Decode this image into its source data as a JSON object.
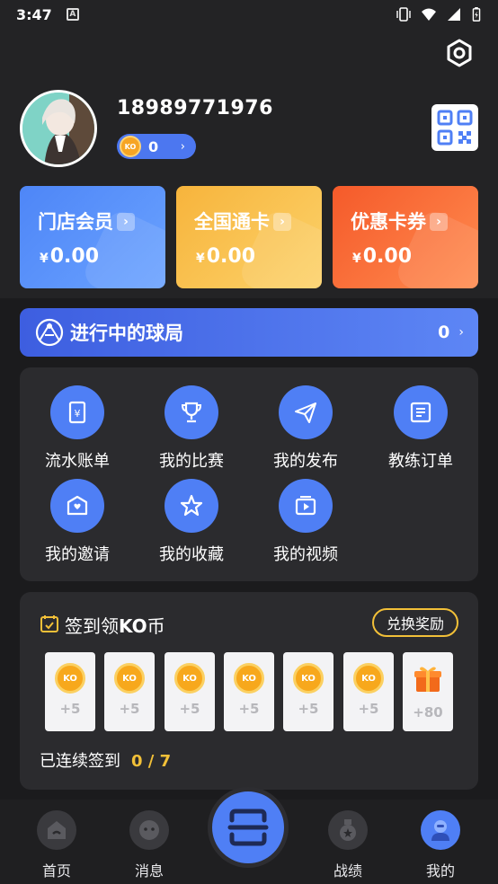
{
  "status_bar": {
    "time": "3:47",
    "notification_letter": "A"
  },
  "profile": {
    "phone": "18989771976",
    "coins": "0",
    "coin_badge": "KO"
  },
  "cards": [
    {
      "title": "门店会员",
      "currency": "¥",
      "amount": "0.00",
      "color": "#4e86f7"
    },
    {
      "title": "全国通卡",
      "currency": "¥",
      "amount": "0.00",
      "color": "#f7b43c"
    },
    {
      "title": "优惠卡券",
      "currency": "¥",
      "amount": "0.00",
      "color": "#f55a2a"
    }
  ],
  "ongoing": {
    "label": "进行中的球局",
    "count": "0"
  },
  "menu": [
    {
      "label": "流水账单",
      "icon": "receipt-icon"
    },
    {
      "label": "我的比赛",
      "icon": "trophy-icon"
    },
    {
      "label": "我的发布",
      "icon": "paper-plane-icon"
    },
    {
      "label": "教练订单",
      "icon": "order-list-icon"
    },
    {
      "label": "我的邀请",
      "icon": "heart-mail-icon"
    },
    {
      "label": "我的收藏",
      "icon": "star-icon"
    },
    {
      "label": "我的视频",
      "icon": "video-icon"
    }
  ],
  "checkin": {
    "title_prefix": "签到领",
    "title_bold": "KO",
    "title_suffix": "币",
    "redeem_label": "兑换奖励",
    "days": [
      {
        "badge": "KO",
        "reward": "+5"
      },
      {
        "badge": "KO",
        "reward": "+5"
      },
      {
        "badge": "KO",
        "reward": "+5"
      },
      {
        "badge": "KO",
        "reward": "+5"
      },
      {
        "badge": "KO",
        "reward": "+5"
      },
      {
        "badge": "KO",
        "reward": "+5"
      },
      {
        "badge": "gift",
        "reward": "+80"
      }
    ],
    "streak_label": "已连续签到",
    "streak_value": "0 / 7"
  },
  "nav": [
    {
      "label": "首页",
      "icon": "home-icon"
    },
    {
      "label": "消息",
      "icon": "message-icon"
    },
    {
      "label": "战绩",
      "icon": "medal-icon"
    },
    {
      "label": "我的",
      "icon": "profile-icon"
    }
  ],
  "colors": {
    "accent": "#4f7ff5",
    "gold": "#f2c038",
    "background": "#1b1b1d",
    "panel": "#2b2b2e"
  }
}
